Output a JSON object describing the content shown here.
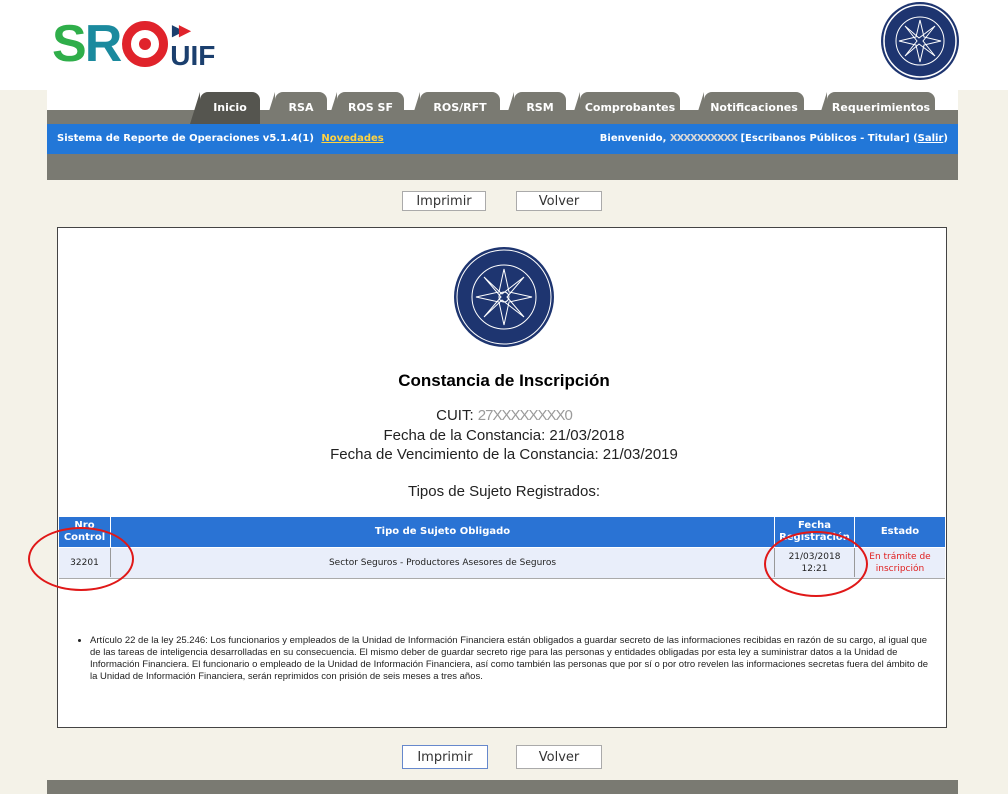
{
  "header": {
    "logo_text": "SRO UIF",
    "seal_text": "ARGENTINA · UNIDAD de INFORMACIÓN FINANCIERA"
  },
  "tabs": [
    {
      "label": "Inicio"
    },
    {
      "label": "RSA"
    },
    {
      "label": "ROS SF"
    },
    {
      "label": "ROS/RFT"
    },
    {
      "label": "RSM"
    },
    {
      "label": "Comprobantes"
    },
    {
      "label": "Notificaciones"
    },
    {
      "label": "Requerimientos"
    }
  ],
  "bluebar": {
    "system": "Sistema de Reporte de Operaciones v5.1.4(1)",
    "novedades": "Novedades",
    "welcome": "Bienvenido,",
    "user_masked": "XXXXXXXXXX",
    "role": "[Escribanos Públicos - Titular]",
    "salir": "Salir"
  },
  "actions": {
    "print": "Imprimir",
    "back": "Volver"
  },
  "certificate": {
    "title": "Constancia de Inscripción",
    "cuit_label": "CUIT:",
    "cuit_value": "27XXXXXXXX0",
    "fecha": "Fecha de la Constancia: 21/03/2018",
    "vencimiento": "Fecha de Vencimiento de la Constancia: 21/03/2019",
    "tipos_title": "Tipos de Sujeto Registrados:"
  },
  "table": {
    "headers": [
      "Nro Control",
      "Tipo de Sujeto Obligado",
      "Fecha Registración",
      "Estado"
    ],
    "rows": [
      {
        "nro": "32201",
        "tipo": "Sector Seguros - Productores Asesores de Seguros",
        "fecha": "21/03/2018 12:21",
        "estado": "En trámite de inscripción"
      }
    ]
  },
  "note": "Artículo 22 de la ley 25.246: Los funcionarios y empleados de la Unidad de Información Financiera están obligados a guardar secreto de las informaciones recibidas en razón de su cargo, al igual que de las tareas de inteligencia desarrolladas en su consecuencia. El mismo deber de guardar secreto rige para las personas y entidades obligadas por esta ley a suministrar datos a la Unidad de Información Financiera. El funcionario o empleado de la Unidad de Información Financiera, así como también las personas que por sí o por otro revelen las informaciones secretas fuera del ámbito de la Unidad de Información Financiera, serán reprimidos con prisión de seis meses a tres años."
}
